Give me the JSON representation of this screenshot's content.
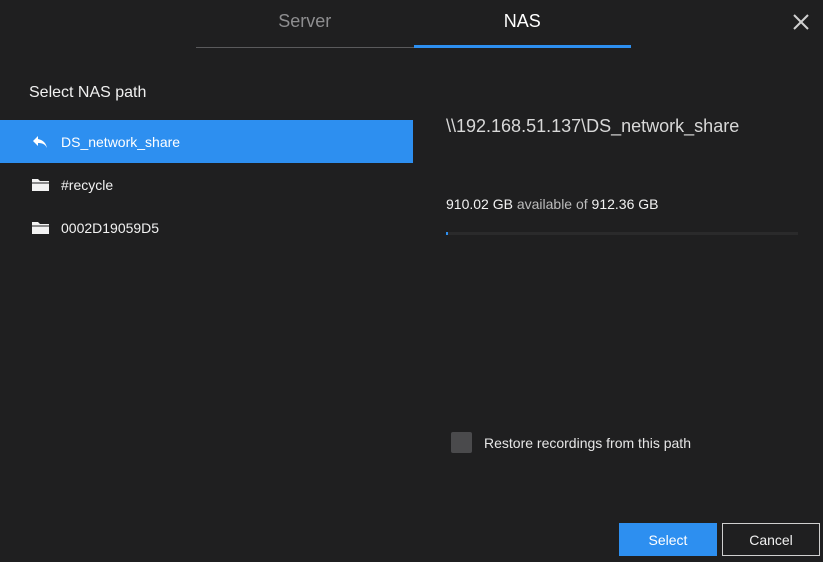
{
  "tabs": [
    {
      "label": "Server",
      "active": false
    },
    {
      "label": "NAS",
      "active": true
    }
  ],
  "left": {
    "title": "Select NAS path",
    "items": [
      {
        "label": "DS_network_share",
        "icon": "back-arrow-icon",
        "selected": true
      },
      {
        "label": "#recycle",
        "icon": "folder-icon",
        "selected": false
      },
      {
        "label": "0002D19059D5",
        "icon": "folder-icon",
        "selected": false
      }
    ]
  },
  "right": {
    "path": "\\\\192.168.51.137\\DS_network_share",
    "available": "910.02 GB",
    "available_of_text": "available of",
    "total": "912.36 GB",
    "used_fraction": 0.0026,
    "restore_label": "Restore recordings from this path",
    "restore_checked": false
  },
  "buttons": {
    "select": "Select",
    "cancel": "Cancel"
  },
  "colors": {
    "accent": "#2d8ff0",
    "background": "#1f1f20"
  }
}
